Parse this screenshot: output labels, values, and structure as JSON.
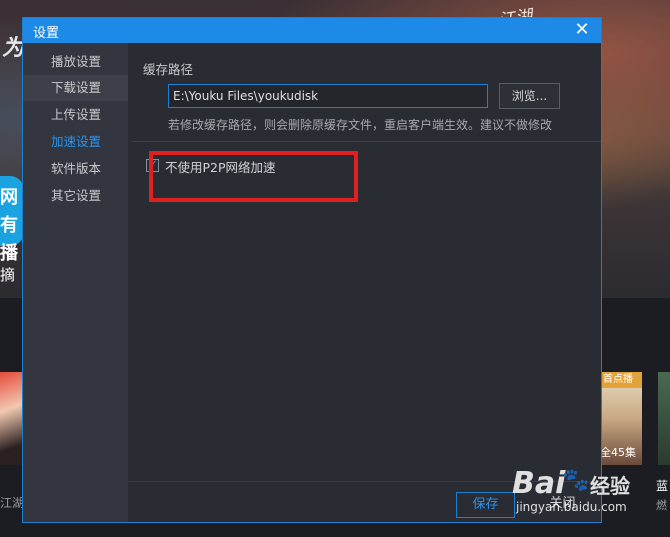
{
  "background": {
    "banner_left_text": "为",
    "banner_badge_text": "网有播",
    "banner_right_text": "江湖",
    "banner_tab_text": "摘",
    "thumb_tag": "首点播",
    "thumb_episodes": "全45集",
    "caption_left": "江湖",
    "caption_right_title": "蓝",
    "caption_right_sub": "燃",
    "caption_mid": "关闭"
  },
  "dialog": {
    "title": "设置",
    "close_icon": "close-icon",
    "sidebar": {
      "items": [
        {
          "label": "播放设置"
        },
        {
          "label": "下载设置"
        },
        {
          "label": "上传设置"
        },
        {
          "label": "加速设置"
        },
        {
          "label": "软件版本"
        },
        {
          "label": "其它设置"
        }
      ],
      "active_index": 3,
      "hover_index": 1
    },
    "cache": {
      "label": "缓存路径",
      "path_value": "E:\\Youku Files\\youkudisk",
      "browse_label": "浏览...",
      "hint": "若修改缓存路径，则会删除原缓存文件，重启客户端生效。建议不做修改"
    },
    "p2p": {
      "label": "不使用P2P网络加速",
      "checked": true
    },
    "footer": {
      "save_label": "保存",
      "close_label": "关闭"
    },
    "accent_color": "#1c8ae6",
    "highlight_color": "#e02020"
  },
  "watermark": {
    "logo": "Bai",
    "logo_suffix": "经验",
    "url": "jingyan.baidu.com"
  }
}
